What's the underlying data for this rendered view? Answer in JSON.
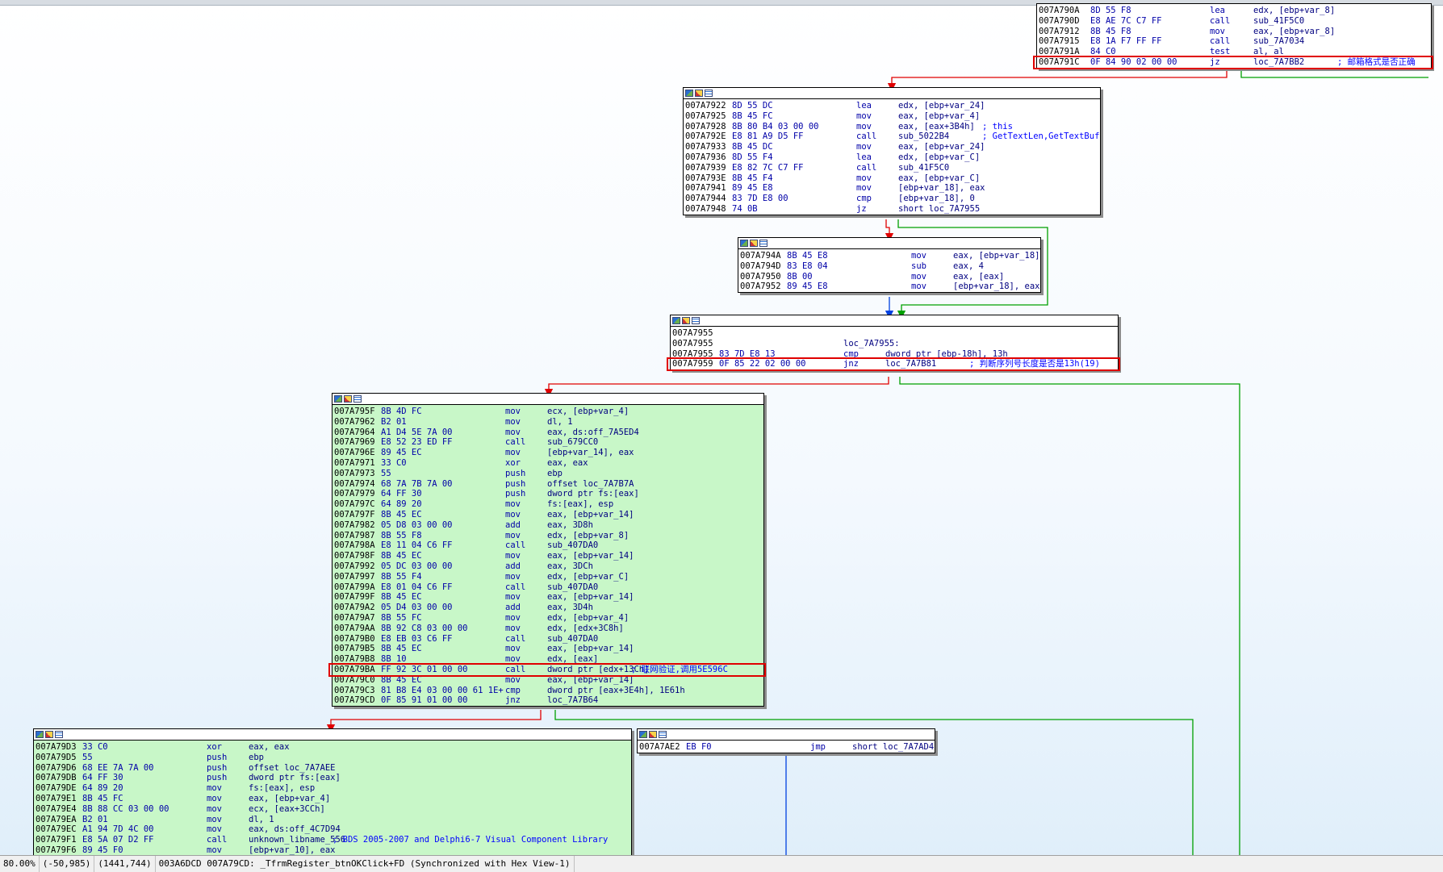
{
  "status": {
    "zoom": "80.00%",
    "mouse": "(-50,985)",
    "coords": "(1441,744)",
    "info": "003A6DCD 007A79CD: _TfrmRegister_btnOKClick+FD (Synchronized with Hex View-1)"
  },
  "colors": {
    "edge_true": "#00a000",
    "edge_false": "#e00000",
    "edge_uncond": "#0040e0",
    "node_green": "#c8f7c8",
    "highlight": "#e00000"
  },
  "icons": [
    "graph-color-icon",
    "graph-edit-icon",
    "graph-list-icon"
  ],
  "nodes": [
    {
      "id": "n0",
      "header": false,
      "green": false,
      "lines": [
        [
          "007A790A",
          "8D 55 F8",
          "lea",
          "edx, [ebp+var_8]",
          ""
        ],
        [
          "007A790D",
          "E8 AE 7C C7 FF",
          "call",
          "sub_41F5C0",
          ""
        ],
        [
          "007A7912",
          "8B 45 F8",
          "mov",
          "eax, [ebp+var_8]",
          ""
        ],
        [
          "007A7915",
          "E8 1A F7 FF FF",
          "call",
          "sub_7A7034",
          ""
        ],
        [
          "007A791A",
          "84 C0",
          "test",
          "al, al",
          ""
        ],
        [
          "007A791C",
          "0F 84 90 02 00 00",
          "jz",
          "loc_7A7BB2",
          "; 邮箱格式是否正确"
        ]
      ]
    },
    {
      "id": "n1",
      "header": true,
      "green": false,
      "lines": [
        [
          "007A7922",
          "8D 55 DC",
          "lea",
          "edx, [ebp+var_24]",
          ""
        ],
        [
          "007A7925",
          "8B 45 FC",
          "mov",
          "eax, [ebp+var_4]",
          ""
        ],
        [
          "007A7928",
          "8B 80 B4 03 00 00",
          "mov",
          "eax, [eax+3B4h]",
          "; this"
        ],
        [
          "007A792E",
          "E8 81 A9 D5 FF",
          "call",
          "sub_5022B4",
          "; GetTextLen,GetTextBuf"
        ],
        [
          "007A7933",
          "8B 45 DC",
          "mov",
          "eax, [ebp+var_24]",
          ""
        ],
        [
          "007A7936",
          "8D 55 F4",
          "lea",
          "edx, [ebp+var_C]",
          ""
        ],
        [
          "007A7939",
          "E8 82 7C C7 FF",
          "call",
          "sub_41F5C0",
          ""
        ],
        [
          "007A793E",
          "8B 45 F4",
          "mov",
          "eax, [ebp+var_C]",
          ""
        ],
        [
          "007A7941",
          "89 45 E8",
          "mov",
          "[ebp+var_18], eax",
          ""
        ],
        [
          "007A7944",
          "83 7D E8 00",
          "cmp",
          "[ebp+var_18], 0",
          ""
        ],
        [
          "007A7948",
          "74 0B",
          "jz",
          "short loc_7A7955",
          ""
        ]
      ]
    },
    {
      "id": "n2",
      "header": true,
      "green": false,
      "lines": [
        [
          "007A794A",
          "8B 45 E8",
          "mov",
          "eax, [ebp+var_18]",
          ""
        ],
        [
          "007A794D",
          "83 E8 04",
          "sub",
          "eax, 4",
          ""
        ],
        [
          "007A7950",
          "8B 00",
          "mov",
          "eax, [eax]",
          ""
        ],
        [
          "007A7952",
          "89 45 E8",
          "mov",
          "[ebp+var_18], eax",
          ""
        ]
      ]
    },
    {
      "id": "n3",
      "header": true,
      "green": false,
      "lines": [
        [
          "007A7955",
          "",
          "",
          "",
          ""
        ],
        [
          "007A7955",
          "",
          "",
          "",
          ""
        ],
        [
          "007A7955",
          "83 7D E8 13",
          "cmp",
          "dword ptr [ebp-18h], 13h",
          ""
        ],
        [
          "007A7959",
          "0F 85 22 02 00 00",
          "jnz",
          "loc_7A7B81",
          "; 判断序列号长度是否是13h(19)"
        ]
      ],
      "label": "loc_7A7955:"
    },
    {
      "id": "n4",
      "header": true,
      "green": true,
      "lines": [
        [
          "007A795F",
          "8B 4D FC",
          "mov",
          "ecx, [ebp+var_4]",
          ""
        ],
        [
          "007A7962",
          "B2 01",
          "mov",
          "dl, 1",
          ""
        ],
        [
          "007A7964",
          "A1 D4 5E 7A 00",
          "mov",
          "eax, ds:off_7A5ED4",
          ""
        ],
        [
          "007A7969",
          "E8 52 23 ED FF",
          "call",
          "sub_679CC0",
          ""
        ],
        [
          "007A796E",
          "89 45 EC",
          "mov",
          "[ebp+var_14], eax",
          ""
        ],
        [
          "007A7971",
          "33 C0",
          "xor",
          "eax, eax",
          ""
        ],
        [
          "007A7973",
          "55",
          "push",
          "ebp",
          ""
        ],
        [
          "007A7974",
          "68 7A 7B 7A 00",
          "push",
          "offset loc_7A7B7A",
          ""
        ],
        [
          "007A7979",
          "64 FF 30",
          "push",
          "dword ptr fs:[eax]",
          ""
        ],
        [
          "007A797C",
          "64 89 20",
          "mov",
          "fs:[eax], esp",
          ""
        ],
        [
          "007A797F",
          "8B 45 EC",
          "mov",
          "eax, [ebp+var_14]",
          ""
        ],
        [
          "007A7982",
          "05 D8 03 00 00",
          "add",
          "eax, 3D8h",
          ""
        ],
        [
          "007A7987",
          "8B 55 F8",
          "mov",
          "edx, [ebp+var_8]",
          ""
        ],
        [
          "007A798A",
          "E8 11 04 C6 FF",
          "call",
          "sub_407DA0",
          ""
        ],
        [
          "007A798F",
          "8B 45 EC",
          "mov",
          "eax, [ebp+var_14]",
          ""
        ],
        [
          "007A7992",
          "05 DC 03 00 00",
          "add",
          "eax, 3DCh",
          ""
        ],
        [
          "007A7997",
          "8B 55 F4",
          "mov",
          "edx, [ebp+var_C]",
          ""
        ],
        [
          "007A799A",
          "E8 01 04 C6 FF",
          "call",
          "sub_407DA0",
          ""
        ],
        [
          "007A799F",
          "8B 45 EC",
          "mov",
          "eax, [ebp+var_14]",
          ""
        ],
        [
          "007A79A2",
          "05 D4 03 00 00",
          "add",
          "eax, 3D4h",
          ""
        ],
        [
          "007A79A7",
          "8B 55 FC",
          "mov",
          "edx, [ebp+var_4]",
          ""
        ],
        [
          "007A79AA",
          "8B 92 C8 03 00 00",
          "mov",
          "edx, [edx+3C8h]",
          ""
        ],
        [
          "007A79B0",
          "E8 EB 03 C6 FF",
          "call",
          "sub_407DA0",
          ""
        ],
        [
          "007A79B5",
          "8B 45 EC",
          "mov",
          "eax, [ebp+var_14]",
          ""
        ],
        [
          "007A79B8",
          "8B 10",
          "mov",
          "edx, [eax]",
          ""
        ],
        [
          "007A79BA",
          "FF 92 3C 01 00 00",
          "call",
          "dword ptr [edx+13Ch]",
          "; 联网验证,调用5E596C"
        ],
        [
          "007A79C0",
          "8B 45 EC",
          "mov",
          "eax, [ebp+var_14]",
          ""
        ],
        [
          "007A79C3",
          "81 B8 E4 03 00 00 61 1E+",
          "cmp",
          "dword ptr [eax+3E4h], 1E61h",
          ""
        ],
        [
          "007A79CD",
          "0F 85 91 01 00 00",
          "jnz",
          "loc_7A7B64",
          ""
        ]
      ]
    },
    {
      "id": "n5",
      "header": true,
      "green": true,
      "lines": [
        [
          "007A79D3",
          "33 C0",
          "xor",
          "eax, eax",
          ""
        ],
        [
          "007A79D5",
          "55",
          "push",
          "ebp",
          ""
        ],
        [
          "007A79D6",
          "68 EE 7A 7A 00",
          "push",
          "offset loc_7A7AEE",
          ""
        ],
        [
          "007A79DB",
          "64 FF 30",
          "push",
          "dword ptr fs:[eax]",
          ""
        ],
        [
          "007A79DE",
          "64 89 20",
          "mov",
          "fs:[eax], esp",
          ""
        ],
        [
          "007A79E1",
          "8B 45 FC",
          "mov",
          "eax, [ebp+var_4]",
          ""
        ],
        [
          "007A79E4",
          "8B 88 CC 03 00 00",
          "mov",
          "ecx, [eax+3CCh]",
          ""
        ],
        [
          "007A79EA",
          "B2 01",
          "mov",
          "dl, 1",
          ""
        ],
        [
          "007A79EC",
          "A1 94 7D 4C 00",
          "mov",
          "eax, ds:off_4C7D94",
          ""
        ],
        [
          "007A79F1",
          "E8 5A 07 D2 FF",
          "call",
          "unknown_libname_556",
          "; BDS 2005-2007 and Delphi6-7 Visual Component Library"
        ],
        [
          "007A79F6",
          "89 45 F0",
          "mov",
          "[ebp+var_10], eax",
          ""
        ]
      ]
    },
    {
      "id": "n6",
      "header": true,
      "green": false,
      "lines": [
        [
          "007A7AE2",
          "EB F0",
          "jmp",
          "short loc_7A7AD4",
          ""
        ]
      ]
    }
  ]
}
